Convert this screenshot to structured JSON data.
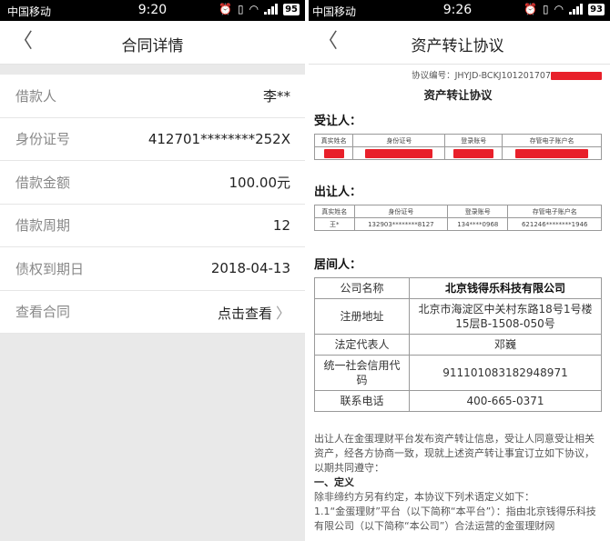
{
  "left": {
    "status": {
      "carrier": "中国移动",
      "time": "9:20",
      "battery": "95"
    },
    "nav": {
      "title": "合同详情"
    },
    "rows": [
      {
        "label": "借款人",
        "value": "李**"
      },
      {
        "label": "身份证号",
        "value": "412701********252X"
      },
      {
        "label": "借款金额",
        "value": "100.00元"
      },
      {
        "label": "借款周期",
        "value": "12"
      },
      {
        "label": "债权到期日",
        "value": "2018-04-13"
      },
      {
        "label": "查看合同",
        "value": "点击查看"
      }
    ]
  },
  "right": {
    "status": {
      "carrier": "中国移动",
      "time": "9:26",
      "battery": "93"
    },
    "nav": {
      "title": "资产转让协议"
    },
    "doc_number": "协议编号：JHYJD-BCKJ101201707",
    "subtitle": "资产转让协议",
    "transferee": {
      "heading": "受让人：",
      "headers": [
        "真实姓名",
        "身份证号",
        "登录账号",
        "存管电子账户名"
      ]
    },
    "transferor": {
      "heading": "出让人：",
      "headers": [
        "真实姓名",
        "身份证号",
        "登录账号",
        "存管电子账户名"
      ],
      "values": [
        "王*",
        "132903********8127",
        "134****0968",
        "621246********1946"
      ]
    },
    "intermediary": {
      "heading": "居间人：",
      "rows": [
        {
          "label": "公司名称",
          "value": "北京钱得乐科技有限公司"
        },
        {
          "label": "注册地址",
          "value": "北京市海淀区中关村东路18号1号楼15层B-1508-050号"
        },
        {
          "label": "法定代表人",
          "value": "邓巍"
        },
        {
          "label": "统一社会信用代码",
          "value": "911101083182948971"
        },
        {
          "label": "联系电话",
          "value": "400-665-0371"
        }
      ]
    },
    "paragraph1": "出让人在金蛋理财平台发布资产转让信息，受让人同意受让相关资产，经各方协商一致，现就上述资产转让事宜订立如下协议，以期共同遵守：",
    "section1_title": "一、定义",
    "paragraph2": "除非缔约方另有约定，本协议下列术语定义如下：",
    "paragraph3": "1.1“金蛋理财”平台（以下简称“本平台”）：指由北京钱得乐科技有限公司（以下简称“本公司”）合法运营的金蛋理财网"
  }
}
